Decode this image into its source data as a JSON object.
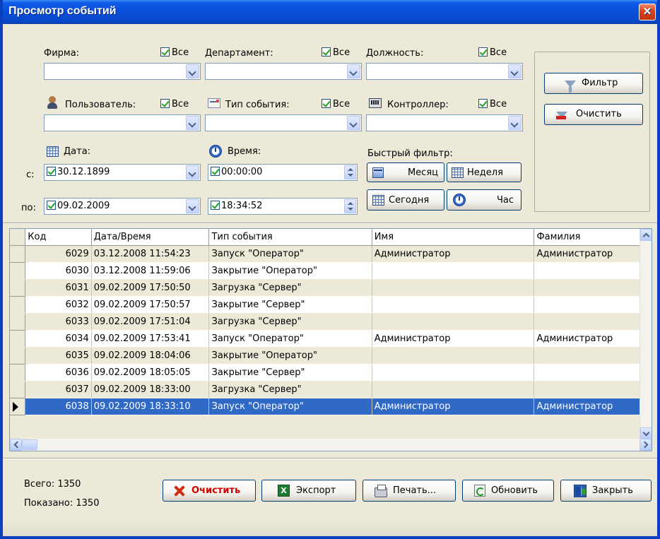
{
  "window": {
    "title": "Просмотр событий",
    "close_label": "✕"
  },
  "filters": {
    "all_label": "Все",
    "firm": {
      "label": "Фирма:",
      "value": ""
    },
    "department": {
      "label": "Департамент:",
      "value": ""
    },
    "position": {
      "label": "Должность:",
      "value": ""
    },
    "user": {
      "label": "Пользователь:",
      "value": ""
    },
    "event_type": {
      "label": "Тип события:",
      "value": ""
    },
    "controller": {
      "label": "Контроллер:",
      "value": ""
    },
    "date": {
      "label": "Дата:",
      "from_label": "с:",
      "to_label": "по:",
      "from": "30.12.1899",
      "to": "09.02.2009"
    },
    "time": {
      "label": "Время:",
      "from": "00:00:00",
      "to": "18:34:52"
    },
    "quick": {
      "label": "Быстрый фильтр:",
      "month": "Месяц",
      "week": "Неделя",
      "today": "Сегодня",
      "hour": "Час"
    },
    "filter_button": "Фильтр",
    "clear_filter_button": "Очистить"
  },
  "grid": {
    "columns": [
      "Код",
      "Дата/Время",
      "Тип события",
      "Имя",
      "Фамилия"
    ],
    "rows": [
      [
        "6029",
        "03.12.2008 11:54:23",
        "Запуск \"Оператор\"",
        "Администратор",
        "Администратор"
      ],
      [
        "6030",
        "03.12.2008 11:59:06",
        "Закрытие \"Оператор\"",
        "",
        ""
      ],
      [
        "6031",
        "09.02.2009 17:50:50",
        "Загрузка \"Сервер\"",
        "",
        ""
      ],
      [
        "6032",
        "09.02.2009 17:50:57",
        "Закрытие \"Сервер\"",
        "",
        ""
      ],
      [
        "6033",
        "09.02.2009 17:51:04",
        "Загрузка \"Сервер\"",
        "",
        ""
      ],
      [
        "6034",
        "09.02.2009 17:53:41",
        "Запуск \"Оператор\"",
        "Администратор",
        "Администратор"
      ],
      [
        "6035",
        "09.02.2009 18:04:06",
        "Закрытие \"Оператор\"",
        "",
        ""
      ],
      [
        "6036",
        "09.02.2009 18:05:05",
        "Закрытие \"Сервер\"",
        "",
        ""
      ],
      [
        "6037",
        "09.02.2009 18:33:00",
        "Загрузка \"Сервер\"",
        "",
        ""
      ],
      [
        "6038",
        "09.02.2009 18:33:10",
        "Запуск \"Оператор\"",
        "Администратор",
        "Администратор"
      ]
    ],
    "selected_row": 9
  },
  "footer": {
    "total": "Всего: 1350",
    "shown": "Показано: 1350",
    "clear": "Очистить",
    "export": "Экспорт",
    "print": "Печать...",
    "refresh": "Обновить",
    "close": "Закрыть"
  },
  "colors": {
    "titlebar": "#0a4fd7",
    "selection": "#3169c6",
    "clear_text": "#d40000"
  }
}
